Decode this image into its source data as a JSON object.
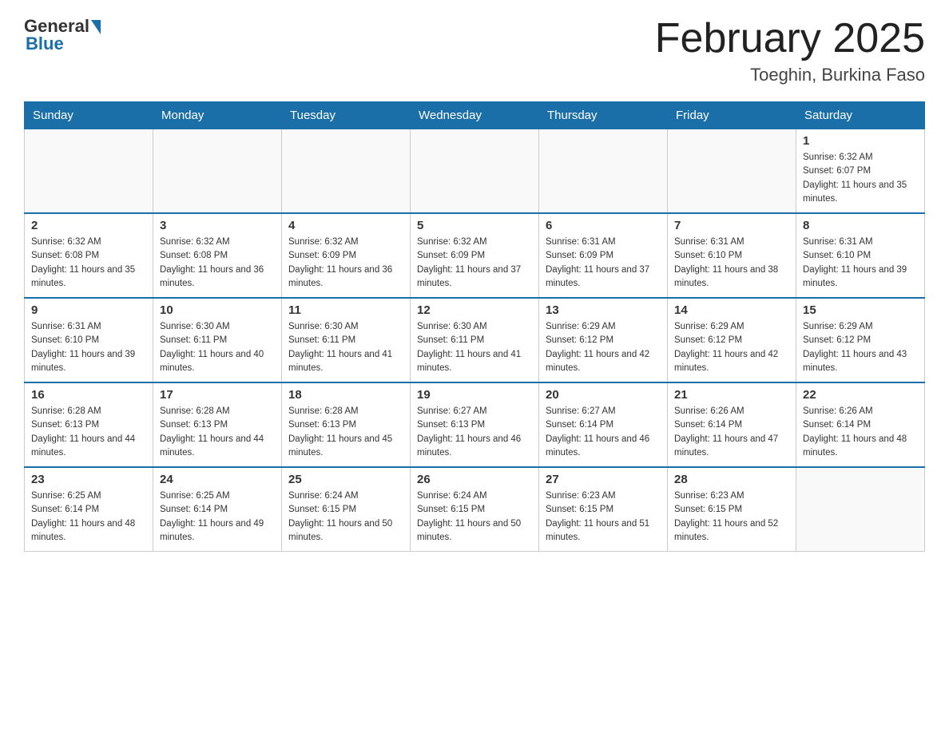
{
  "header": {
    "logo_general": "General",
    "logo_blue": "Blue",
    "month_title": "February 2025",
    "location": "Toeghin, Burkina Faso"
  },
  "weekdays": [
    "Sunday",
    "Monday",
    "Tuesday",
    "Wednesday",
    "Thursday",
    "Friday",
    "Saturday"
  ],
  "weeks": [
    [
      {
        "day": "",
        "sunrise": "",
        "sunset": "",
        "daylight": ""
      },
      {
        "day": "",
        "sunrise": "",
        "sunset": "",
        "daylight": ""
      },
      {
        "day": "",
        "sunrise": "",
        "sunset": "",
        "daylight": ""
      },
      {
        "day": "",
        "sunrise": "",
        "sunset": "",
        "daylight": ""
      },
      {
        "day": "",
        "sunrise": "",
        "sunset": "",
        "daylight": ""
      },
      {
        "day": "",
        "sunrise": "",
        "sunset": "",
        "daylight": ""
      },
      {
        "day": "1",
        "sunrise": "Sunrise: 6:32 AM",
        "sunset": "Sunset: 6:07 PM",
        "daylight": "Daylight: 11 hours and 35 minutes."
      }
    ],
    [
      {
        "day": "2",
        "sunrise": "Sunrise: 6:32 AM",
        "sunset": "Sunset: 6:08 PM",
        "daylight": "Daylight: 11 hours and 35 minutes."
      },
      {
        "day": "3",
        "sunrise": "Sunrise: 6:32 AM",
        "sunset": "Sunset: 6:08 PM",
        "daylight": "Daylight: 11 hours and 36 minutes."
      },
      {
        "day": "4",
        "sunrise": "Sunrise: 6:32 AM",
        "sunset": "Sunset: 6:09 PM",
        "daylight": "Daylight: 11 hours and 36 minutes."
      },
      {
        "day": "5",
        "sunrise": "Sunrise: 6:32 AM",
        "sunset": "Sunset: 6:09 PM",
        "daylight": "Daylight: 11 hours and 37 minutes."
      },
      {
        "day": "6",
        "sunrise": "Sunrise: 6:31 AM",
        "sunset": "Sunset: 6:09 PM",
        "daylight": "Daylight: 11 hours and 37 minutes."
      },
      {
        "day": "7",
        "sunrise": "Sunrise: 6:31 AM",
        "sunset": "Sunset: 6:10 PM",
        "daylight": "Daylight: 11 hours and 38 minutes."
      },
      {
        "day": "8",
        "sunrise": "Sunrise: 6:31 AM",
        "sunset": "Sunset: 6:10 PM",
        "daylight": "Daylight: 11 hours and 39 minutes."
      }
    ],
    [
      {
        "day": "9",
        "sunrise": "Sunrise: 6:31 AM",
        "sunset": "Sunset: 6:10 PM",
        "daylight": "Daylight: 11 hours and 39 minutes."
      },
      {
        "day": "10",
        "sunrise": "Sunrise: 6:30 AM",
        "sunset": "Sunset: 6:11 PM",
        "daylight": "Daylight: 11 hours and 40 minutes."
      },
      {
        "day": "11",
        "sunrise": "Sunrise: 6:30 AM",
        "sunset": "Sunset: 6:11 PM",
        "daylight": "Daylight: 11 hours and 41 minutes."
      },
      {
        "day": "12",
        "sunrise": "Sunrise: 6:30 AM",
        "sunset": "Sunset: 6:11 PM",
        "daylight": "Daylight: 11 hours and 41 minutes."
      },
      {
        "day": "13",
        "sunrise": "Sunrise: 6:29 AM",
        "sunset": "Sunset: 6:12 PM",
        "daylight": "Daylight: 11 hours and 42 minutes."
      },
      {
        "day": "14",
        "sunrise": "Sunrise: 6:29 AM",
        "sunset": "Sunset: 6:12 PM",
        "daylight": "Daylight: 11 hours and 42 minutes."
      },
      {
        "day": "15",
        "sunrise": "Sunrise: 6:29 AM",
        "sunset": "Sunset: 6:12 PM",
        "daylight": "Daylight: 11 hours and 43 minutes."
      }
    ],
    [
      {
        "day": "16",
        "sunrise": "Sunrise: 6:28 AM",
        "sunset": "Sunset: 6:13 PM",
        "daylight": "Daylight: 11 hours and 44 minutes."
      },
      {
        "day": "17",
        "sunrise": "Sunrise: 6:28 AM",
        "sunset": "Sunset: 6:13 PM",
        "daylight": "Daylight: 11 hours and 44 minutes."
      },
      {
        "day": "18",
        "sunrise": "Sunrise: 6:28 AM",
        "sunset": "Sunset: 6:13 PM",
        "daylight": "Daylight: 11 hours and 45 minutes."
      },
      {
        "day": "19",
        "sunrise": "Sunrise: 6:27 AM",
        "sunset": "Sunset: 6:13 PM",
        "daylight": "Daylight: 11 hours and 46 minutes."
      },
      {
        "day": "20",
        "sunrise": "Sunrise: 6:27 AM",
        "sunset": "Sunset: 6:14 PM",
        "daylight": "Daylight: 11 hours and 46 minutes."
      },
      {
        "day": "21",
        "sunrise": "Sunrise: 6:26 AM",
        "sunset": "Sunset: 6:14 PM",
        "daylight": "Daylight: 11 hours and 47 minutes."
      },
      {
        "day": "22",
        "sunrise": "Sunrise: 6:26 AM",
        "sunset": "Sunset: 6:14 PM",
        "daylight": "Daylight: 11 hours and 48 minutes."
      }
    ],
    [
      {
        "day": "23",
        "sunrise": "Sunrise: 6:25 AM",
        "sunset": "Sunset: 6:14 PM",
        "daylight": "Daylight: 11 hours and 48 minutes."
      },
      {
        "day": "24",
        "sunrise": "Sunrise: 6:25 AM",
        "sunset": "Sunset: 6:14 PM",
        "daylight": "Daylight: 11 hours and 49 minutes."
      },
      {
        "day": "25",
        "sunrise": "Sunrise: 6:24 AM",
        "sunset": "Sunset: 6:15 PM",
        "daylight": "Daylight: 11 hours and 50 minutes."
      },
      {
        "day": "26",
        "sunrise": "Sunrise: 6:24 AM",
        "sunset": "Sunset: 6:15 PM",
        "daylight": "Daylight: 11 hours and 50 minutes."
      },
      {
        "day": "27",
        "sunrise": "Sunrise: 6:23 AM",
        "sunset": "Sunset: 6:15 PM",
        "daylight": "Daylight: 11 hours and 51 minutes."
      },
      {
        "day": "28",
        "sunrise": "Sunrise: 6:23 AM",
        "sunset": "Sunset: 6:15 PM",
        "daylight": "Daylight: 11 hours and 52 minutes."
      },
      {
        "day": "",
        "sunrise": "",
        "sunset": "",
        "daylight": ""
      }
    ]
  ]
}
